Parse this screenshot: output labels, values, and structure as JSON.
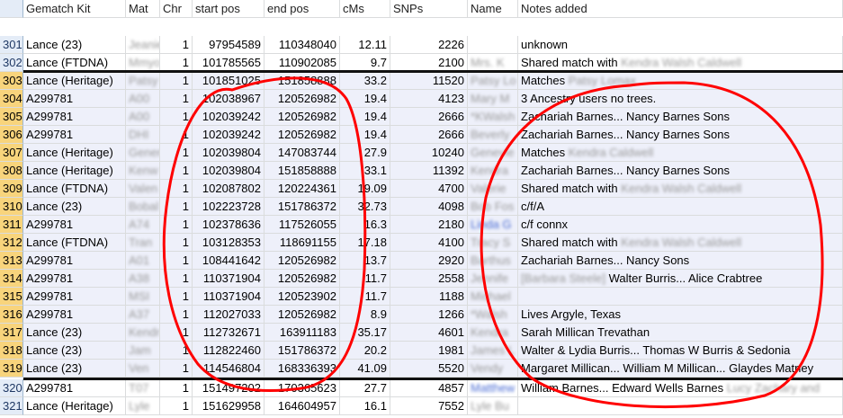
{
  "headers": [
    "Gematch Kit",
    "Mat",
    "Chr",
    "start pos",
    "end pos",
    "cMs",
    "SNPs",
    "Name",
    "Notes added"
  ],
  "rows": [
    {
      "num": "301",
      "kit": "Lance (23)",
      "mat": "Jeanie",
      "chr": "1",
      "start": "97954589",
      "end": "110348040",
      "cms": "12.11",
      "snps": "2226",
      "name": "",
      "name_link": false,
      "notes": "unknown",
      "notes_blur": ""
    },
    {
      "num": "302",
      "kit": "Lance (FTDNA)",
      "mat": "Mmyo",
      "chr": "1",
      "start": "101785565",
      "end": "110902085",
      "cms": "9.7",
      "snps": "2100",
      "name": "Mrs. K",
      "name_link": false,
      "notes": "Shared match with",
      "notes_blur": "Kendra Walsh Caldwell"
    },
    {
      "num": "303",
      "kit": "Lance (Heritage)",
      "mat": "Patsy",
      "chr": "1",
      "start": "101851025",
      "end": "151858888",
      "cms": "33.2",
      "snps": "11520",
      "name": "Patsy Lo",
      "name_link": false,
      "notes": "Matches",
      "notes_blur": "Patsy Lomax"
    },
    {
      "num": "304",
      "kit": "A299781",
      "mat": "A00",
      "chr": "1",
      "start": "102038967",
      "end": "120526982",
      "cms": "19.4",
      "snps": "4123",
      "name": "Mary M",
      "name_link": false,
      "notes": "3 Ancestry users no trees.",
      "notes_blur": ""
    },
    {
      "num": "305",
      "kit": "A299781",
      "mat": "A00",
      "chr": "1",
      "start": "102039242",
      "end": "120526982",
      "cms": "19.4",
      "snps": "2666",
      "name": "*KWalsh",
      "name_link": false,
      "notes": "Zachariah Barnes... Nancy Barnes Sons",
      "notes_blur": ""
    },
    {
      "num": "306",
      "kit": "A299781",
      "mat": "DHI",
      "chr": "1",
      "start": "102039242",
      "end": "120526982",
      "cms": "19.4",
      "snps": "2666",
      "name": "Beverly",
      "name_link": false,
      "notes": "Zachariah Barnes... Nancy Barnes Sons",
      "notes_blur": ""
    },
    {
      "num": "307",
      "kit": "Lance (Heritage)",
      "mat": "Gener",
      "chr": "1",
      "start": "102039804",
      "end": "147083744",
      "cms": "27.9",
      "snps": "10240",
      "name": "Genevie",
      "name_link": false,
      "notes": "Matches",
      "notes_blur": "Kendra Caldwell"
    },
    {
      "num": "308",
      "kit": "Lance (Heritage)",
      "mat": "Kenw",
      "chr": "1",
      "start": "102039804",
      "end": "151858888",
      "cms": "33.1",
      "snps": "11392",
      "name": "Kendra",
      "name_link": false,
      "notes": "Zachariah Barnes... Nancy Barnes Sons",
      "notes_blur": ""
    },
    {
      "num": "309",
      "kit": "Lance (FTDNA)",
      "mat": "Valen",
      "chr": "1",
      "start": "102087802",
      "end": "120224361",
      "cms": "19.09",
      "snps": "4700",
      "name": "Valerie",
      "name_link": false,
      "notes": "Shared match with",
      "notes_blur": "Kendra Walsh Caldwell"
    },
    {
      "num": "310",
      "kit": "Lance (23)",
      "mat": "Bobal",
      "chr": "1",
      "start": "102223728",
      "end": "151786372",
      "cms": "32.73",
      "snps": "4098",
      "name": "Bob Fos",
      "name_link": false,
      "notes": "c/f/A",
      "notes_blur": ""
    },
    {
      "num": "311",
      "kit": "A299781",
      "mat": "A74",
      "chr": "1",
      "start": "102378636",
      "end": "117526055",
      "cms": "16.3",
      "snps": "2180",
      "name": "Linda G",
      "name_link": true,
      "notes": "c/f connx",
      "notes_blur": ""
    },
    {
      "num": "312",
      "kit": "Lance (FTDNA)",
      "mat": "Tran",
      "chr": "1",
      "start": "103128353",
      "end": "118691155",
      "cms": "17.18",
      "snps": "4100",
      "name": "Tracy S",
      "name_link": false,
      "notes": "Shared match with",
      "notes_blur": "Kendra Walsh Caldwell"
    },
    {
      "num": "313",
      "kit": "A299781",
      "mat": "A01",
      "chr": "1",
      "start": "108441642",
      "end": "120526982",
      "cms": "13.7",
      "snps": "2920",
      "name": "Barthus",
      "name_link": false,
      "notes": "Zachariah Barnes... Nancy Sons",
      "notes_blur": ""
    },
    {
      "num": "314",
      "kit": "A299781",
      "mat": "A38",
      "chr": "1",
      "start": "110371904",
      "end": "120526982",
      "cms": "11.7",
      "snps": "2558",
      "name": "Jennife",
      "name_link": false,
      "notes": "Walter Burris... Alice Crabtree",
      "notes_blur": "[Barbara Steele]"
    },
    {
      "num": "315",
      "kit": "A299781",
      "mat": "MSI",
      "chr": "1",
      "start": "110371904",
      "end": "120523902",
      "cms": "11.7",
      "snps": "1188",
      "name": "Michael",
      "name_link": false,
      "notes": "",
      "notes_blur": ""
    },
    {
      "num": "316",
      "kit": "A299781",
      "mat": "A37",
      "chr": "1",
      "start": "112027033",
      "end": "120526982",
      "cms": "8.9",
      "snps": "1266",
      "name": "*Walsh",
      "name_link": false,
      "notes": "Lives Argyle, Texas",
      "notes_blur": ""
    },
    {
      "num": "317",
      "kit": "Lance (23)",
      "mat": "Kendr",
      "chr": "1",
      "start": "112732671",
      "end": "163911183",
      "cms": "35.17",
      "snps": "4601",
      "name": "Kendra",
      "name_link": false,
      "notes": "Sarah Millican Trevathan",
      "notes_blur": ""
    },
    {
      "num": "318",
      "kit": "Lance (23)",
      "mat": "Jam",
      "chr": "1",
      "start": "112822460",
      "end": "151786372",
      "cms": "20.2",
      "snps": "1981",
      "name": "James L",
      "name_link": false,
      "notes": "Walter & Lydia Burris... Thomas W Burris & Sedonia",
      "notes_blur": ""
    },
    {
      "num": "319",
      "kit": "Lance (23)",
      "mat": "Ven",
      "chr": "1",
      "start": "114546804",
      "end": "168336393",
      "cms": "41.09",
      "snps": "5520",
      "name": "Vendy",
      "name_link": false,
      "notes": "Margaret Millican... William M Millican... Glaydes Matney",
      "notes_blur": ""
    },
    {
      "num": "320",
      "kit": "A299781",
      "mat": "T07",
      "chr": "1",
      "start": "151497202",
      "end": "170365623",
      "cms": "27.7",
      "snps": "4857",
      "name": "Matthew",
      "name_link": true,
      "notes": "William Barnes... Edward Wells Barnes",
      "notes_blur": "Lucy Zachary and"
    },
    {
      "num": "321",
      "kit": "Lance (Heritage)",
      "mat": "Lyle",
      "chr": "1",
      "start": "151629958",
      "end": "164604957",
      "cms": "16.1",
      "snps": "7552",
      "name": "Lyle Bu",
      "name_link": false,
      "notes": "",
      "notes_blur": ""
    }
  ],
  "colors": {
    "header_bg": "#e4ecf7",
    "row_highlight": "#eef0fa",
    "selected_rownum": "#f8d47c",
    "annotation_red": "#ff0000"
  }
}
